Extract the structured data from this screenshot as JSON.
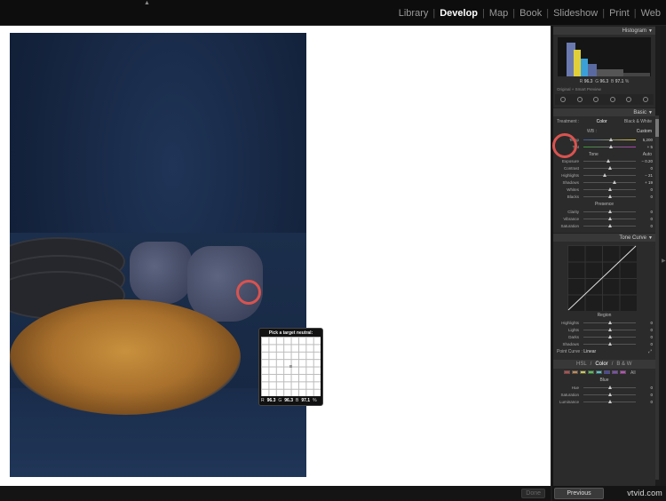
{
  "modules": [
    "Library",
    "Develop",
    "Map",
    "Book",
    "Slideshow",
    "Print",
    "Web"
  ],
  "active_module": "Develop",
  "loupe": {
    "title": "Pick a target neutral:",
    "readout": {
      "r_label": "R",
      "r": "96.3",
      "g_label": "G",
      "g": "96.3",
      "b_label": "B",
      "b": "97.1",
      "unit": "%"
    }
  },
  "done_label": "Done",
  "histogram": {
    "title": "Histogram",
    "r_label": "R",
    "r": "96.3",
    "g_label": "G",
    "g": "96.3",
    "b_label": "B",
    "b": "97.1",
    "unit": "%",
    "preview": "Original + Smart Preview"
  },
  "basic": {
    "title": "Basic",
    "treatment_label": "Treatment :",
    "color": "Color",
    "bw": "Black & White",
    "wb_label": "WB :",
    "wb_value": "Custom",
    "temp": {
      "label": "Temp",
      "value": "5,200",
      "pos": 0.52
    },
    "tint": {
      "label": "Tint",
      "value": "+ 5",
      "pos": 0.52
    },
    "tone_label": "Tone",
    "auto_label": "Auto",
    "exposure": {
      "label": "Exposure",
      "value": "− 0.20",
      "pos": 0.47
    },
    "contrast": {
      "label": "Contrast",
      "value": "0",
      "pos": 0.5
    },
    "highlights": {
      "label": "Highlights",
      "value": "− 21",
      "pos": 0.4
    },
    "shadows": {
      "label": "Shadows",
      "value": "+ 19",
      "pos": 0.6
    },
    "whites": {
      "label": "Whites",
      "value": "0",
      "pos": 0.5
    },
    "blacks": {
      "label": "Blacks",
      "value": "0",
      "pos": 0.5
    },
    "presence_label": "Presence",
    "clarity": {
      "label": "Clarity",
      "value": "0",
      "pos": 0.5
    },
    "vibrance": {
      "label": "Vibrance",
      "value": "0",
      "pos": 0.5
    },
    "saturation": {
      "label": "Saturation",
      "value": "0",
      "pos": 0.5
    }
  },
  "tone_curve": {
    "title": "Tone Curve",
    "region_label": "Region",
    "highlights": {
      "label": "Highlights",
      "value": "0",
      "pos": 0.5
    },
    "lights": {
      "label": "Lights",
      "value": "0",
      "pos": 0.5
    },
    "darks": {
      "label": "Darks",
      "value": "0",
      "pos": 0.5
    },
    "shadows": {
      "label": "Shadows",
      "value": "0",
      "pos": 0.5
    },
    "point_curve_label": "Point Curve :",
    "point_curve_value": "Linear"
  },
  "hsl": {
    "hsl": "HSL",
    "color": "Color",
    "bw": "B & W",
    "all": "All",
    "swatch_colors": [
      "#c44",
      "#c84",
      "#cc4",
      "#4c4",
      "#4cc",
      "#44c",
      "#84c",
      "#c4c"
    ],
    "blue_label": "Blue",
    "hue": {
      "label": "Hue",
      "value": "0",
      "pos": 0.5
    },
    "saturation": {
      "label": "Saturation",
      "value": "0",
      "pos": 0.5
    },
    "luminance": {
      "label": "Luminance",
      "value": "0",
      "pos": 0.5
    }
  },
  "previous_label": "Previous",
  "watermark": "vtvid.com",
  "colors": {
    "highlight_ring": "#d9534f",
    "panel_bg": "#2b2b2b",
    "canvas_bg": "#ffffff"
  }
}
